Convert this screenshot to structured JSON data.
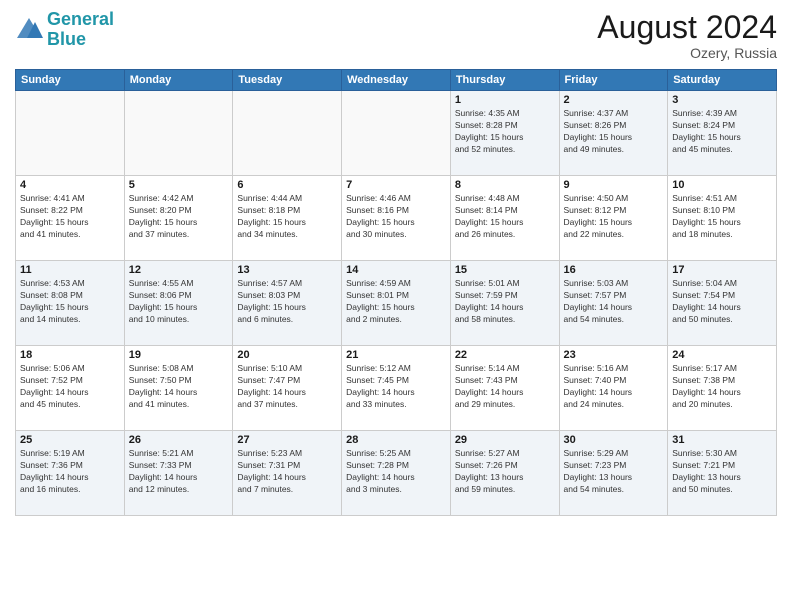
{
  "logo": {
    "line1": "General",
    "line2": "Blue"
  },
  "title": "August 2024",
  "location": "Ozery, Russia",
  "days_of_week": [
    "Sunday",
    "Monday",
    "Tuesday",
    "Wednesday",
    "Thursday",
    "Friday",
    "Saturday"
  ],
  "weeks": [
    [
      {
        "day": "",
        "info": ""
      },
      {
        "day": "",
        "info": ""
      },
      {
        "day": "",
        "info": ""
      },
      {
        "day": "",
        "info": ""
      },
      {
        "day": "1",
        "info": "Sunrise: 4:35 AM\nSunset: 8:28 PM\nDaylight: 15 hours\nand 52 minutes."
      },
      {
        "day": "2",
        "info": "Sunrise: 4:37 AM\nSunset: 8:26 PM\nDaylight: 15 hours\nand 49 minutes."
      },
      {
        "day": "3",
        "info": "Sunrise: 4:39 AM\nSunset: 8:24 PM\nDaylight: 15 hours\nand 45 minutes."
      }
    ],
    [
      {
        "day": "4",
        "info": "Sunrise: 4:41 AM\nSunset: 8:22 PM\nDaylight: 15 hours\nand 41 minutes."
      },
      {
        "day": "5",
        "info": "Sunrise: 4:42 AM\nSunset: 8:20 PM\nDaylight: 15 hours\nand 37 minutes."
      },
      {
        "day": "6",
        "info": "Sunrise: 4:44 AM\nSunset: 8:18 PM\nDaylight: 15 hours\nand 34 minutes."
      },
      {
        "day": "7",
        "info": "Sunrise: 4:46 AM\nSunset: 8:16 PM\nDaylight: 15 hours\nand 30 minutes."
      },
      {
        "day": "8",
        "info": "Sunrise: 4:48 AM\nSunset: 8:14 PM\nDaylight: 15 hours\nand 26 minutes."
      },
      {
        "day": "9",
        "info": "Sunrise: 4:50 AM\nSunset: 8:12 PM\nDaylight: 15 hours\nand 22 minutes."
      },
      {
        "day": "10",
        "info": "Sunrise: 4:51 AM\nSunset: 8:10 PM\nDaylight: 15 hours\nand 18 minutes."
      }
    ],
    [
      {
        "day": "11",
        "info": "Sunrise: 4:53 AM\nSunset: 8:08 PM\nDaylight: 15 hours\nand 14 minutes."
      },
      {
        "day": "12",
        "info": "Sunrise: 4:55 AM\nSunset: 8:06 PM\nDaylight: 15 hours\nand 10 minutes."
      },
      {
        "day": "13",
        "info": "Sunrise: 4:57 AM\nSunset: 8:03 PM\nDaylight: 15 hours\nand 6 minutes."
      },
      {
        "day": "14",
        "info": "Sunrise: 4:59 AM\nSunset: 8:01 PM\nDaylight: 15 hours\nand 2 minutes."
      },
      {
        "day": "15",
        "info": "Sunrise: 5:01 AM\nSunset: 7:59 PM\nDaylight: 14 hours\nand 58 minutes."
      },
      {
        "day": "16",
        "info": "Sunrise: 5:03 AM\nSunset: 7:57 PM\nDaylight: 14 hours\nand 54 minutes."
      },
      {
        "day": "17",
        "info": "Sunrise: 5:04 AM\nSunset: 7:54 PM\nDaylight: 14 hours\nand 50 minutes."
      }
    ],
    [
      {
        "day": "18",
        "info": "Sunrise: 5:06 AM\nSunset: 7:52 PM\nDaylight: 14 hours\nand 45 minutes."
      },
      {
        "day": "19",
        "info": "Sunrise: 5:08 AM\nSunset: 7:50 PM\nDaylight: 14 hours\nand 41 minutes."
      },
      {
        "day": "20",
        "info": "Sunrise: 5:10 AM\nSunset: 7:47 PM\nDaylight: 14 hours\nand 37 minutes."
      },
      {
        "day": "21",
        "info": "Sunrise: 5:12 AM\nSunset: 7:45 PM\nDaylight: 14 hours\nand 33 minutes."
      },
      {
        "day": "22",
        "info": "Sunrise: 5:14 AM\nSunset: 7:43 PM\nDaylight: 14 hours\nand 29 minutes."
      },
      {
        "day": "23",
        "info": "Sunrise: 5:16 AM\nSunset: 7:40 PM\nDaylight: 14 hours\nand 24 minutes."
      },
      {
        "day": "24",
        "info": "Sunrise: 5:17 AM\nSunset: 7:38 PM\nDaylight: 14 hours\nand 20 minutes."
      }
    ],
    [
      {
        "day": "25",
        "info": "Sunrise: 5:19 AM\nSunset: 7:36 PM\nDaylight: 14 hours\nand 16 minutes."
      },
      {
        "day": "26",
        "info": "Sunrise: 5:21 AM\nSunset: 7:33 PM\nDaylight: 14 hours\nand 12 minutes."
      },
      {
        "day": "27",
        "info": "Sunrise: 5:23 AM\nSunset: 7:31 PM\nDaylight: 14 hours\nand 7 minutes."
      },
      {
        "day": "28",
        "info": "Sunrise: 5:25 AM\nSunset: 7:28 PM\nDaylight: 14 hours\nand 3 minutes."
      },
      {
        "day": "29",
        "info": "Sunrise: 5:27 AM\nSunset: 7:26 PM\nDaylight: 13 hours\nand 59 minutes."
      },
      {
        "day": "30",
        "info": "Sunrise: 5:29 AM\nSunset: 7:23 PM\nDaylight: 13 hours\nand 54 minutes."
      },
      {
        "day": "31",
        "info": "Sunrise: 5:30 AM\nSunset: 7:21 PM\nDaylight: 13 hours\nand 50 minutes."
      }
    ]
  ]
}
